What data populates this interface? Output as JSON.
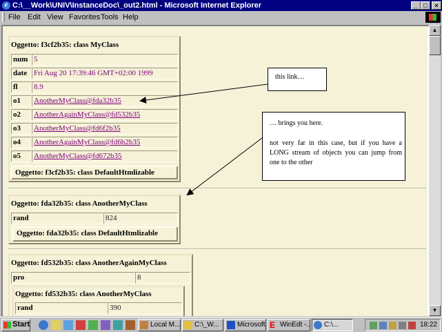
{
  "window": {
    "title": "C:\\__Work\\UNIV\\InstanceDoc\\_out2.html - Microsoft Internet Explorer",
    "controls": [
      "_",
      "□",
      "×"
    ]
  },
  "menu": {
    "items": [
      "File",
      "Edit",
      "View",
      "Favorites",
      "Tools",
      "Help"
    ]
  },
  "objects": [
    {
      "header": "Oggetto: f3cf2b35: class MyClass",
      "fields": [
        {
          "key": "num",
          "value": "5"
        },
        {
          "key": "date",
          "value": "Fri Aug 20 17:39:46 GMT+02:00 1999"
        },
        {
          "key": "fl",
          "value": "8.9"
        },
        {
          "key": "o1",
          "value": "AnotherMyClass@fda32b35"
        },
        {
          "key": "o2",
          "value": "AnotherAgainMyClass@fd532b35"
        },
        {
          "key": "o3",
          "value": "AnotherMyClass@fd6f2b35"
        },
        {
          "key": "o4",
          "value": "AnotherAgainMyClass@fd6b2b35"
        },
        {
          "key": "o5",
          "value": "AnotherMyClass@fd672b35"
        }
      ],
      "nested": "Oggetto: f3cf2b35: class DefaultHtmlizable"
    },
    {
      "header": "Oggetto: fda32b35: class AnotherMyClass",
      "fields": [
        {
          "key": "rand",
          "value": "824"
        }
      ],
      "nested": "Oggetto: fda32b35: class DefaultHtmlizable"
    },
    {
      "header": "Oggetto: fd532b35: class AnotherAgainMyClass",
      "fields": [
        {
          "key": "pro",
          "value": "8"
        }
      ],
      "nested_header": "Oggetto: fd532b35: class AnotherMyClass",
      "nested_fields": [
        {
          "key": "rand",
          "value": "390"
        }
      ]
    }
  ],
  "callouts": {
    "first": "this link…",
    "second_line1": "… brings you here.",
    "second_line2": "not very far in this case, but if you have a LONG stream of objects you can jump from one to the other"
  },
  "taskbar": {
    "start": "Start",
    "buttons": [
      "Local M...",
      "C:\\_W...",
      "Microsoft...",
      "WinEdt -...",
      "C:\\..."
    ],
    "clock": "18:22"
  },
  "colors": {
    "titlebar": "#000080",
    "page_background": "#f5f2d8",
    "link": "#800080"
  }
}
